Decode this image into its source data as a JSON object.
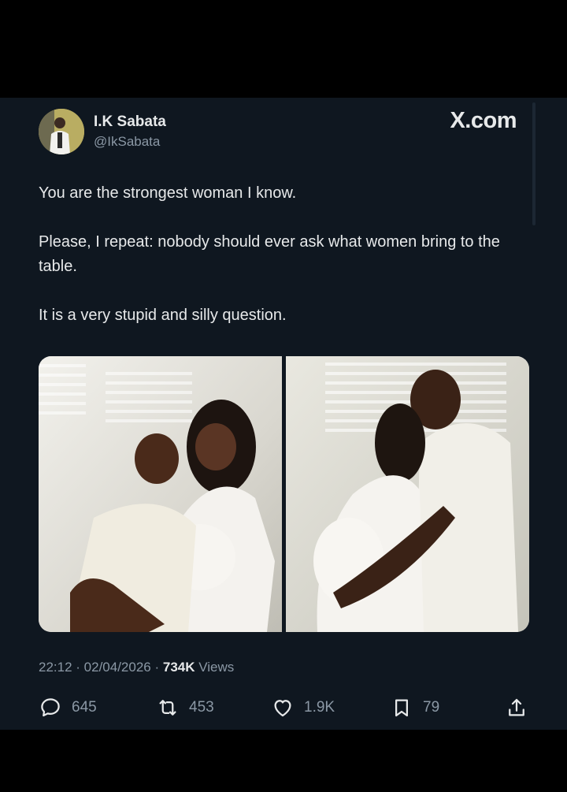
{
  "source": "X.com",
  "author": {
    "name": "I.K Sabata",
    "handle": "@IkSabata"
  },
  "tweet": {
    "paragraphs": [
      "You are the strongest woman I know.",
      "Please, I repeat: nobody should ever ask what women bring to the table.",
      "It is a very stupid and silly question."
    ]
  },
  "media": [
    {
      "name": "photo-couple-kneeling"
    },
    {
      "name": "photo-couple-embracing"
    }
  ],
  "meta": {
    "time": "22:12",
    "date": "02/04/2026",
    "views_count": "734K",
    "views_label": "Views"
  },
  "actions": {
    "replies": {
      "icon": "reply-icon",
      "count": "645"
    },
    "reposts": {
      "icon": "repost-icon",
      "count": "453"
    },
    "likes": {
      "icon": "heart-icon",
      "count": "1.9K"
    },
    "bookmarks": {
      "icon": "bookmark-icon",
      "count": "79"
    },
    "share": {
      "icon": "share-icon"
    }
  },
  "colors": {
    "background": "#000000",
    "card": "#0f1720",
    "text": "#e7e9ea",
    "secondary_text": "#8b98a5"
  }
}
